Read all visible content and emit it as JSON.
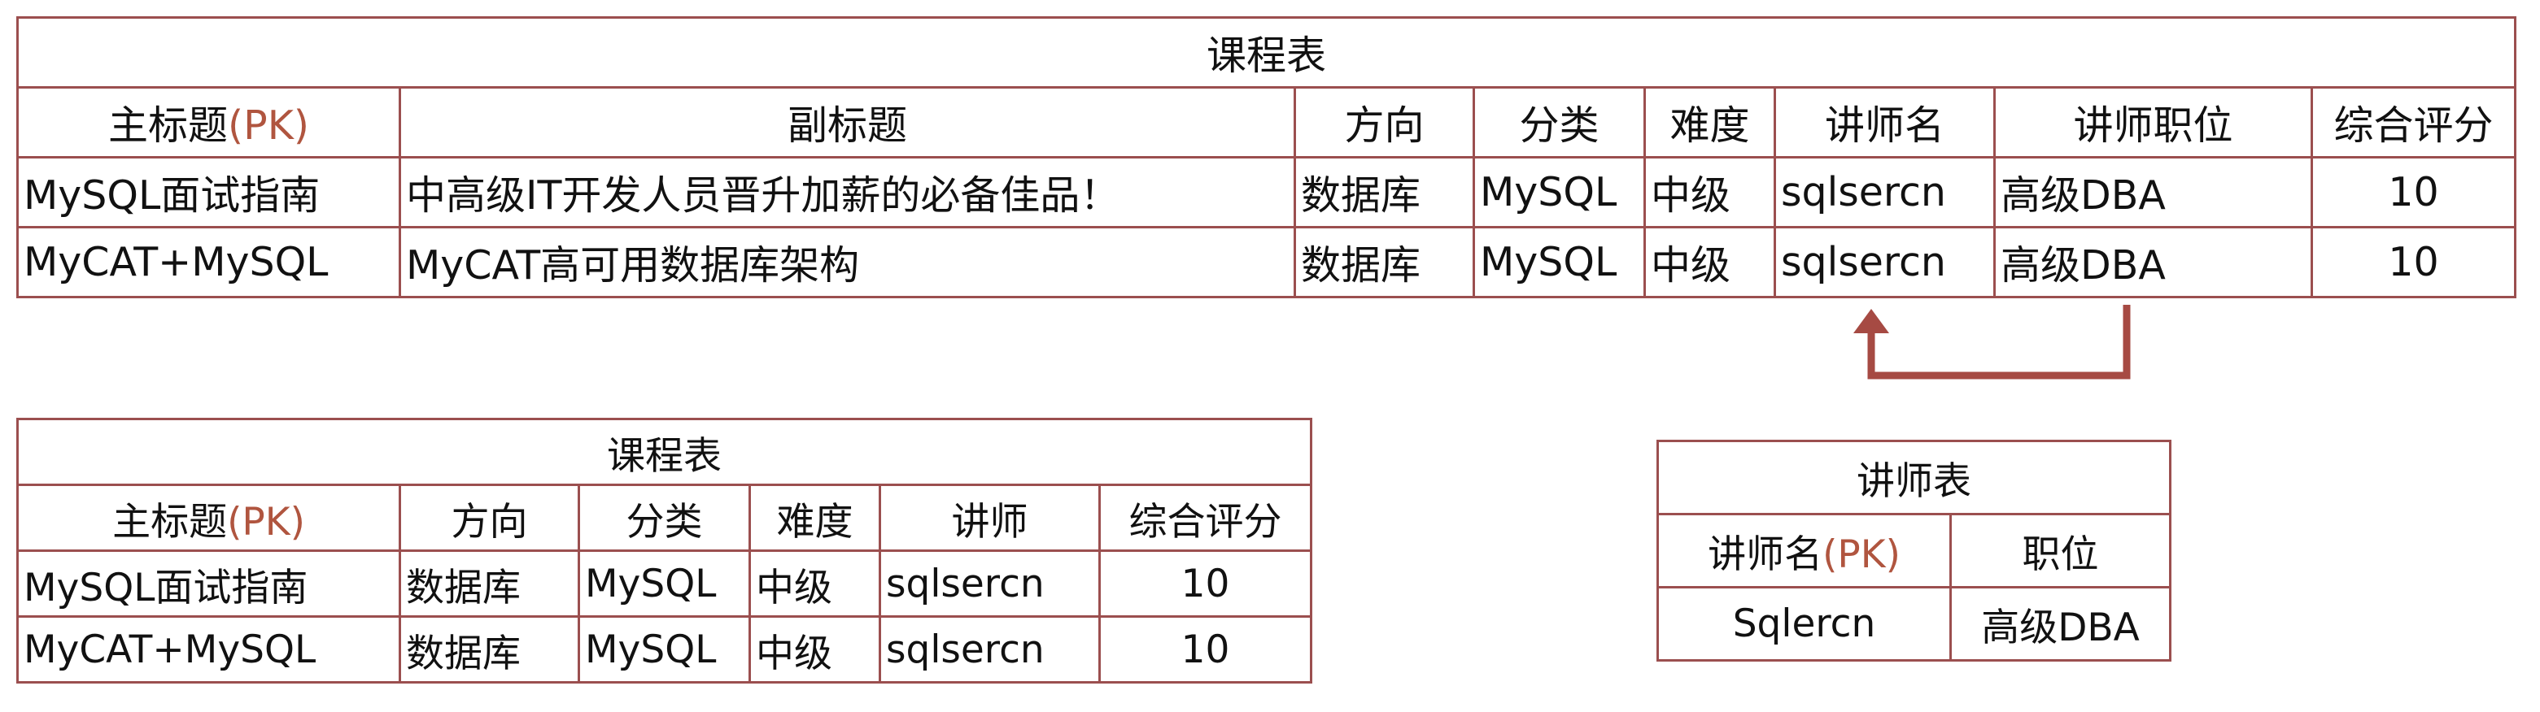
{
  "course_full": {
    "title": "课程表",
    "headers": {
      "main_title": "主标题",
      "pk": "(PK)",
      "subtitle": "副标题",
      "direction": "方向",
      "category": "分类",
      "difficulty": "难度",
      "teacher_name": "讲师名",
      "teacher_title": "讲师职位",
      "rating": "综合评分"
    },
    "rows": [
      {
        "main_title": "MySQL面试指南",
        "subtitle": "中高级IT开发人员晋升加薪的必备佳品！",
        "direction": "数据库",
        "category": "MySQL",
        "difficulty": "中级",
        "teacher_name": "sqlsercn",
        "teacher_title": "高级DBA",
        "rating": "10"
      },
      {
        "main_title": "MyCAT+MySQL",
        "subtitle": "MyCAT高可用数据库架构",
        "direction": "数据库",
        "category": "MySQL",
        "difficulty": "中级",
        "teacher_name": "sqlsercn",
        "teacher_title": "高级DBA",
        "rating": "10"
      }
    ]
  },
  "course_split": {
    "title": "课程表",
    "headers": {
      "main_title": "主标题",
      "pk": "(PK)",
      "direction": "方向",
      "category": "分类",
      "difficulty": "难度",
      "teacher": "讲师",
      "rating": "综合评分"
    },
    "rows": [
      {
        "main_title": "MySQL面试指南",
        "direction": "数据库",
        "category": "MySQL",
        "difficulty": "中级",
        "teacher": "sqlsercn",
        "rating": "10"
      },
      {
        "main_title": "MyCAT+MySQL",
        "direction": "数据库",
        "category": "MySQL",
        "difficulty": "中级",
        "teacher": "sqlsercn",
        "rating": "10"
      }
    ]
  },
  "teacher_table": {
    "title": "讲师表",
    "headers": {
      "teacher_name": "讲师名",
      "pk": "(PK)",
      "position": "职位"
    },
    "rows": [
      {
        "teacher_name": "Sqlercn",
        "position": "高级DBA"
      }
    ]
  },
  "colors": {
    "border": "#9b4f4f",
    "pk_highlight": "#b0553f",
    "arrow": "#a64a43"
  }
}
